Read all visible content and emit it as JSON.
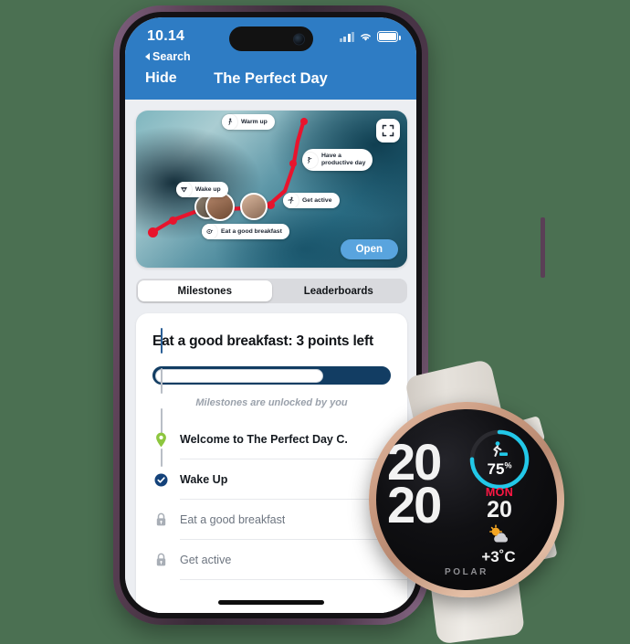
{
  "background_color": "#4B7052",
  "phone": {
    "frame_color": "#5d4257",
    "status_bar": {
      "time": "10.14",
      "back_label": "Search",
      "signal_icon": "cellular-signal-icon",
      "wifi_icon": "wifi-icon",
      "battery_icon": "battery-icon"
    },
    "nav": {
      "left_action": "Hide",
      "title": "The Perfect Day",
      "header_color": "#2E7CC4"
    },
    "map": {
      "expand_icon": "expand-fullscreen-icon",
      "open_button": "Open",
      "open_button_color": "#59A4DE",
      "route_color": "#E8142D",
      "markers": [
        {
          "label": "Warm up",
          "icon": "stretching-person-icon"
        },
        {
          "label": "Have a\nproductive day",
          "icon": "productivity-icon"
        },
        {
          "label": "Wake up",
          "icon": "alarm-icon"
        },
        {
          "label": "Get active",
          "icon": "running-person-icon"
        },
        {
          "label": "Eat a good breakfast",
          "icon": "breakfast-icon"
        }
      ],
      "avatars": [
        {
          "name": "avatar-participant-1"
        },
        {
          "name": "avatar-participant-2"
        },
        {
          "name": "avatar-participant-3"
        }
      ]
    },
    "tabs": [
      {
        "label": "Milestones",
        "active": true
      },
      {
        "label": "Leaderboards",
        "active": false
      }
    ],
    "milestone_card": {
      "title": "Eat a good breakfast: 3 points left",
      "progress_percent": 72,
      "progress_track_color": "#123D63",
      "subtitle": "Milestones are unlocked by you",
      "items": [
        {
          "label": "Welcome to The Perfect Day C.",
          "state": "current",
          "icon": "location-pin-icon",
          "icon_color": "#8DC63F"
        },
        {
          "label": "Wake Up",
          "state": "done",
          "icon": "check-circle-icon",
          "icon_color": "#14427A"
        },
        {
          "label": "Eat a good breakfast",
          "state": "locked",
          "icon": "lock-icon",
          "icon_color": "#A8AEB6"
        },
        {
          "label": "Get active",
          "state": "locked",
          "icon": "lock-icon",
          "icon_color": "#A8AEB6"
        }
      ]
    }
  },
  "watch": {
    "brand": "POLAR",
    "time": "20\n20",
    "time_line1": "20",
    "time_line2": "20",
    "activity_percent": "75",
    "activity_percent_symbol": "%",
    "activity_icon": "walking-person-icon",
    "activity_ring_color": "#22C8E8",
    "day": "MON",
    "day_color": "#FF1744",
    "date": "20",
    "temperature": "+3˚C",
    "weather_icon": "partly-cloudy-icon",
    "bezel_color": "#c99a80",
    "strap_color": "#e6e2dc"
  }
}
